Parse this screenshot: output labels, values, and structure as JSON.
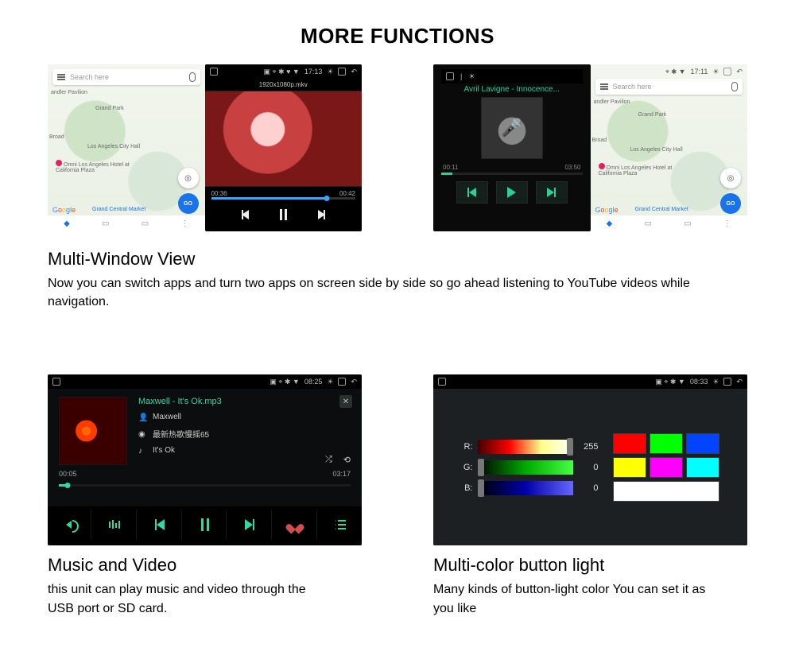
{
  "page_title": "MORE FUNCTIONS",
  "sections": {
    "multiwindow": {
      "title": "Multi-Window View",
      "desc": "Now you can switch apps and turn two apps on screen side by side so go ahead listening to YouTube videos while navigation."
    },
    "musicvideo": {
      "title": "Music and Video",
      "desc": "this unit can play music and video through the USB port or SD card."
    },
    "buttonlight": {
      "title": "Multi-color button light",
      "desc": "Many kinds of button-light color You can set it as you like"
    }
  },
  "panel1": {
    "status_time": "17:13",
    "search_placeholder": "Search here",
    "map_labels": {
      "chandler": "andler Pavilion",
      "grandpark": "Grand Park",
      "broad": "Broad",
      "cityhall": "Los Angeles City Hall",
      "omni": "Omni Los Angeles Hotel at California Plaza",
      "market": "Grand Central Market"
    },
    "go_label": "GO",
    "video_filename": "1920x1080p.mkv",
    "video_elapsed": "00:36",
    "video_total": "00:42"
  },
  "panel2": {
    "track": "Avril Lavigne - Innocence...",
    "elapsed": "00:11",
    "total": "03:50",
    "search_placeholder": "Search here",
    "status_time": "17:11",
    "map_labels": {
      "chandler": "andler Pavilion",
      "grandpark": "Grand Park",
      "broad": "Broad",
      "cityhall": "Los Angeles City Hall",
      "omni": "Omni Los Angeles Hotel at California Plaza",
      "market": "Grand Central Market"
    },
    "go_label": "GO"
  },
  "panel3": {
    "status_time": "08:25",
    "title": "Maxwell - It's Ok.mp3",
    "artist": "Maxwell",
    "album": "最新热歌慢摇65",
    "song": "It's Ok",
    "elapsed": "00:05",
    "total": "03:17"
  },
  "panel4": {
    "status_time": "08:33",
    "r_label": "R:",
    "g_label": "G:",
    "b_label": "B:",
    "r_val": "255",
    "g_val": "0",
    "b_val": "0",
    "swatches": [
      "#ff0000",
      "#00ff00",
      "#0044ff",
      "#ffff00",
      "#ff00ff",
      "#00ffff"
    ]
  }
}
